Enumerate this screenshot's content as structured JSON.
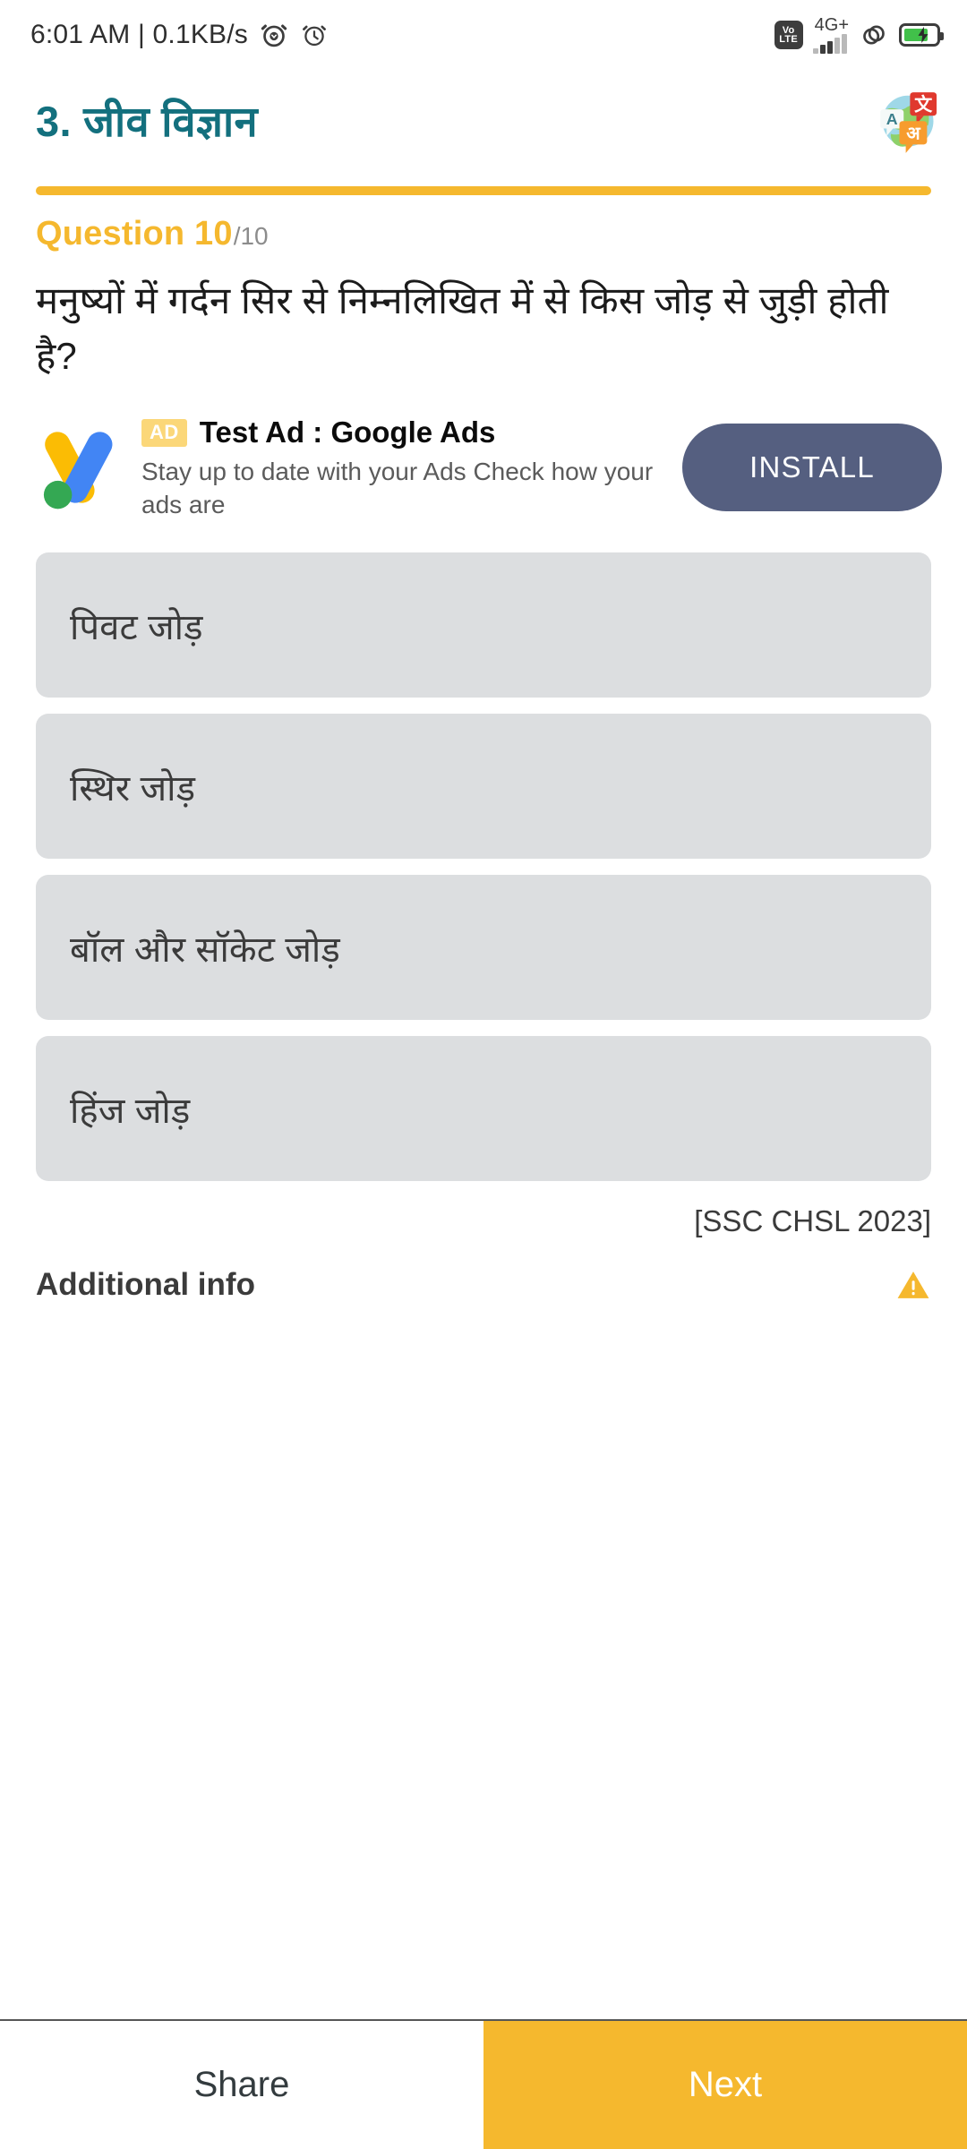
{
  "status_bar": {
    "clock_text": "6:01 AM | 0.1KB/s",
    "alarm_icon": "alarm-clock-icon",
    "clock_icon": "clock-icon",
    "volte_top": "Vo",
    "volte_bottom": "LTE",
    "network_label": "4G+",
    "signal_icon": "signal-bars-icon",
    "sync_icon": "sync-circle-icon",
    "battery_icon": "battery-charging-icon"
  },
  "header": {
    "title": "3. जीव विज्ञान",
    "translate_icon": "translate-globe-icon",
    "translate_glyph_a": "A",
    "translate_glyph_cjk": "文",
    "translate_glyph_hi": "अ"
  },
  "progress": {
    "percent": 100,
    "color": "#f5b82e"
  },
  "question": {
    "label": "Question 10",
    "total": "/10",
    "text": "मनुष्यों में गर्दन सिर से निम्नलिखित में से किस जोड़ से जुड़ी होती है?",
    "source": "[SSC CHSL 2023]"
  },
  "ad": {
    "logo_icon": "google-ads-logo-icon",
    "badge": "AD",
    "title": "Test Ad : Google Ads",
    "description": "Stay up to date with your Ads Check how your ads are",
    "cta_label": "INSTALL",
    "cta_color": "#555f80"
  },
  "options": [
    {
      "label": "पिवट जोड़"
    },
    {
      "label": "स्थिर जोड़"
    },
    {
      "label": "बॉल और सॉकेट जोड़"
    },
    {
      "label": "हिंज जोड़"
    }
  ],
  "additional_info": {
    "label": "Additional info",
    "warning_icon": "warning-triangle-icon",
    "warning_color": "#f5b82e"
  },
  "bottom_bar": {
    "share_label": "Share",
    "next_label": "Next",
    "next_color": "#f5b82e"
  }
}
